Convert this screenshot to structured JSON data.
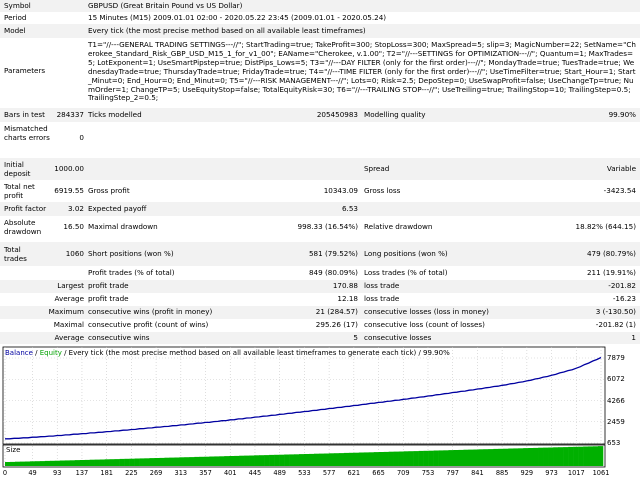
{
  "report": {
    "symbol_label": "Symbol",
    "symbol_value": "GBPUSD (Great Britain Pound vs US Dollar)",
    "period_label": "Period",
    "period_value": "15 Minutes (M15) 2009.01.01 02:00 - 2020.05.22 23:45 (2009.01.01 - 2020.05.24)",
    "model_label": "Model",
    "model_value": "Every tick (the most precise method based on all available least timeframes)",
    "parameters_label": "Parameters",
    "parameters_value": "T1=\"//---GENERAL TRADING SETTINGS---//\"; StartTrading=true; TakeProfit=300; StopLoss=300; MaxSpread=5; slip=3; MagicNumber=22; SetName=\"Cherokee_Standard_Risk_GBP_USD_M15_1_for_v1_00\"; EAName=\"Cherokee, v.1.00\"; T2=\"//---SETTINGS for OPTIMIZATION---//\"; Quantum=1; MaxTrades=5; LotExponent=1; UseSmartPipstep=true; DistPips_Lows=5; T3=\"//---DAY FILTER (only for the first order)---//\"; MondayTrade=true; TuesTrade=true; WednesdayTrade=true; ThursdayTrade=true; FridayTrade=true; T4=\"//---TIME FILTER (only for the first order)---//\"; UseTimeFilter=true; Start_Hour=1; Start_Minut=0; End_Hour=0; End_Minut=0; T5=\"//---RISK MANAGEMENT---//\"; Lots=0; Risk=2.5; DepoStep=0; UseSwapProfit=false; UseChangeTp=true; NumOrder=1; ChangeTP=5; UseEquityStop=false; TotalEquityRisk=30; T6=\"//---TRAILING STOP---//\"; UseTreiling=true; TrailingStop=10; TrailingStep=0.5; TrailingStep_2=0.5;",
    "bars_label": "Bars in test",
    "bars_value": "284337",
    "ticks_label": "Ticks modelled",
    "ticks_value": "205450983",
    "quality_label": "Modelling quality",
    "quality_value": "99.90%",
    "mismatched_label": "Mismatched charts errors",
    "mismatched_value": "0",
    "deposit_label": "Initial deposit",
    "deposit_value": "1000.00",
    "spread_label": "Spread",
    "spread_value": "Variable",
    "netprofit_label": "Total net profit",
    "netprofit_value": "6919.55",
    "grossprofit_label": "Gross profit",
    "grossprofit_value": "10343.09",
    "grossloss_label": "Gross loss",
    "grossloss_value": "-3423.54",
    "pf_label": "Profit factor",
    "pf_value": "3.02",
    "payoff_label": "Expected payoff",
    "payoff_value": "6.53",
    "absdd_label": "Absolute drawdown",
    "absdd_value": "16.50",
    "maxdd_label": "Maximal drawdown",
    "maxdd_value": "998.33 (16.54%)",
    "reldd_label": "Relative drawdown",
    "reldd_value": "18.82% (644.15)",
    "trades_label": "Total trades",
    "trades_value": "1060",
    "short_label": "Short positions (won %)",
    "short_value": "581 (79.52%)",
    "long_label": "Long positions (won %)",
    "long_value": "479 (80.79%)",
    "proftrades_label": "Profit trades (% of total)",
    "proftrades_value": "849 (80.09%)",
    "losstrades_label": "Loss trades (% of total)",
    "losstrades_value": "211 (19.91%)",
    "largest_label": "Largest",
    "largest_profit_label": "profit trade",
    "largest_profit_value": "170.88",
    "largest_loss_label": "loss trade",
    "largest_loss_value": "-201.82",
    "average_label": "Average",
    "average_profit_label": "profit trade",
    "average_profit_value": "12.18",
    "average_loss_label": "loss trade",
    "average_loss_value": "-16.23",
    "maximum_label": "Maximum",
    "maxwins_label": "consecutive wins (profit in money)",
    "maxwins_value": "21 (284.57)",
    "maxlosses_label": "consecutive losses (loss in money)",
    "maxlosses_value": "3 (-130.50)",
    "maximal_label": "Maximal",
    "maxprofit_label": "consecutive profit (count of wins)",
    "maxprofit_value": "295.26 (17)",
    "maxloss_label": "consecutive loss (count of losses)",
    "maxloss_value": "-201.82 (1)",
    "average2_label": "Average",
    "avgwins_label": "consecutive wins",
    "avgwins_value": "5",
    "avglosses_label": "consecutive losses",
    "avglosses_value": "1"
  },
  "chart_legend": {
    "balance": "Balance",
    "sep1": " / ",
    "equity": "Equity",
    "rest": " / Every tick (the most precise method based on all available least timeframes to generate each tick) / 99.90%"
  },
  "size_label": "Size",
  "colors": {
    "balance": "#0000a0",
    "equity": "#00a000",
    "size": "#00b000"
  },
  "chart_data": {
    "type": "line",
    "title": "",
    "xlabel": "",
    "ylabel": "",
    "y_ticks": [
      "7879",
      "6072",
      "4266",
      "2459",
      "653"
    ],
    "x_ticks": [
      "0",
      "49",
      "93",
      "137",
      "181",
      "225",
      "269",
      "313",
      "357",
      "401",
      "445",
      "489",
      "533",
      "577",
      "621",
      "665",
      "709",
      "753",
      "797",
      "841",
      "885",
      "929",
      "973",
      "1017",
      "1061"
    ],
    "ylim": [
      653,
      7879
    ],
    "xlim": [
      0,
      1061
    ],
    "series": [
      {
        "name": "Balance",
        "x": [
          0,
          49,
          93,
          137,
          181,
          225,
          269,
          313,
          357,
          401,
          445,
          489,
          533,
          577,
          621,
          665,
          709,
          753,
          797,
          841,
          885,
          929,
          973,
          1017,
          1061
        ],
        "values": [
          1000,
          1130,
          1280,
          1440,
          1610,
          1790,
          1980,
          2180,
          2390,
          2610,
          2840,
          3080,
          3320,
          3570,
          3830,
          4090,
          4360,
          4640,
          4930,
          5230,
          5550,
          5920,
          6400,
          7000,
          7920
        ]
      }
    ]
  }
}
